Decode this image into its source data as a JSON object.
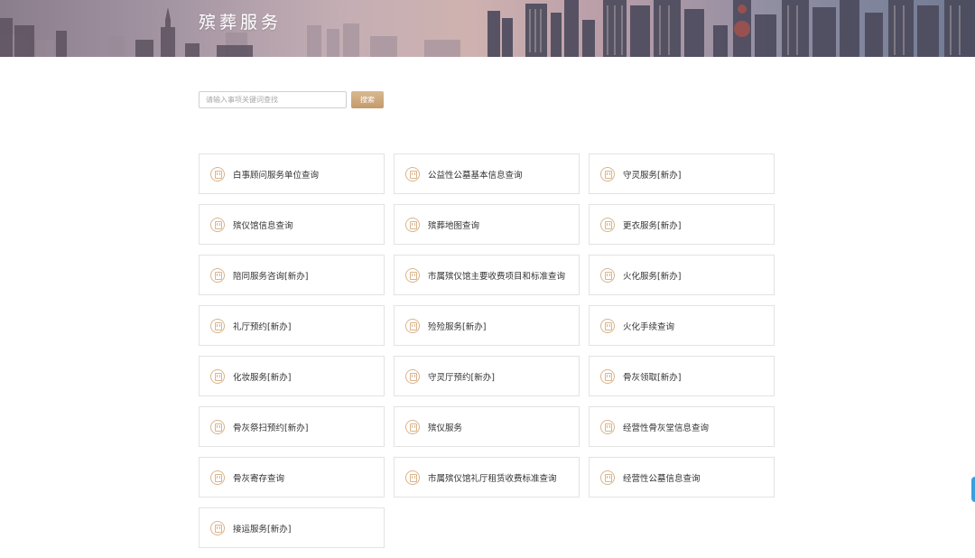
{
  "header": {
    "title": "殡葬服务"
  },
  "search": {
    "placeholder": "请输入事项关键词查找",
    "button_label": "搜索"
  },
  "icon": "certificate-icon",
  "colors": {
    "accent": "#c8a074",
    "icon": "#d9b48b",
    "card_border": "#e3e3e3",
    "side_tab": "#3a9ee0"
  },
  "services": [
    {
      "label": "白事顾问服务单位查询"
    },
    {
      "label": "公益性公墓基本信息查询"
    },
    {
      "label": "守灵服务[新办]"
    },
    {
      "label": "殡仪馆信息查询"
    },
    {
      "label": "殡葬地图查询"
    },
    {
      "label": "更衣服务[新办]"
    },
    {
      "label": "陪同服务咨询[新办]"
    },
    {
      "label": "市属殡仪馆主要收费项目和标准查询"
    },
    {
      "label": "火化服务[新办]"
    },
    {
      "label": "礼厅预约[新办]"
    },
    {
      "label": "殓殓服务[新办]"
    },
    {
      "label": "火化手续查询"
    },
    {
      "label": "化妆服务[新办]"
    },
    {
      "label": "守灵厅预约[新办]"
    },
    {
      "label": "骨灰领取[新办]"
    },
    {
      "label": "骨灰祭扫预约[新办]"
    },
    {
      "label": "殡仪服务"
    },
    {
      "label": "经营性骨灰堂信息查询"
    },
    {
      "label": "骨灰寄存查询"
    },
    {
      "label": "市属殡仪馆礼厅租赁收费标准查询"
    },
    {
      "label": "经营性公墓信息查询"
    },
    {
      "label": "接运服务[新办]"
    }
  ]
}
